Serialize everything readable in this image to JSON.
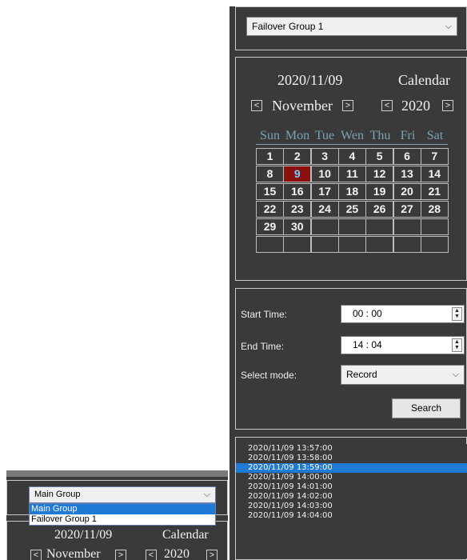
{
  "group_select": {
    "value": "Failover Group 1",
    "arrow": "⌵"
  },
  "calendar": {
    "date": "2020/11/09",
    "title": "Calendar",
    "month": "November",
    "year": "2020",
    "prev": "<",
    "next": ">",
    "weekdays": [
      "Sun",
      "Mon",
      "Tue",
      "Wen",
      "Thu",
      "Fri",
      "Sat"
    ],
    "weeks": [
      [
        "1",
        "2",
        "3",
        "4",
        "5",
        "6",
        "7"
      ],
      [
        "8",
        "9",
        "10",
        "11",
        "12",
        "13",
        "14"
      ],
      [
        "15",
        "16",
        "17",
        "18",
        "19",
        "20",
        "21"
      ],
      [
        "22",
        "23",
        "24",
        "25",
        "26",
        "27",
        "28"
      ],
      [
        "29",
        "30",
        "",
        "",
        "",
        "",
        ""
      ],
      [
        "",
        "",
        "",
        "",
        "",
        "",
        ""
      ]
    ],
    "selected_day": "9"
  },
  "search_form": {
    "start_label": "Start Time:",
    "start_value": "00 : 00",
    "end_label": "End Time:",
    "end_value": "14 : 04",
    "mode_label": "Select mode:",
    "mode_value": "Record",
    "search_label": "Search",
    "spin_up": "▲",
    "spin_down": "▼"
  },
  "results": {
    "items": [
      "2020/11/09 13:57:00",
      "2020/11/09 13:58:00",
      "2020/11/09 13:59:00",
      "2020/11/09 14:00:00",
      "2020/11/09 14:01:00",
      "2020/11/09 14:02:00",
      "2020/11/09 14:03:00",
      "2020/11/09 14:04:00"
    ],
    "selected_index": 2
  },
  "inset": {
    "group_select_value": "Main Group",
    "dropdown_options": [
      "Main Group",
      "Failover Group 1"
    ],
    "date": "2020/11/09",
    "title": "Calendar",
    "month": "November",
    "year": "2020",
    "prev": "<",
    "next": ">"
  },
  "colors": {
    "panel_bg": "#3a3a3a",
    "selected_day_bg": "#8b1010",
    "selection_blue": "#1f7ad6",
    "weekday_text": "#7aa3b5"
  }
}
